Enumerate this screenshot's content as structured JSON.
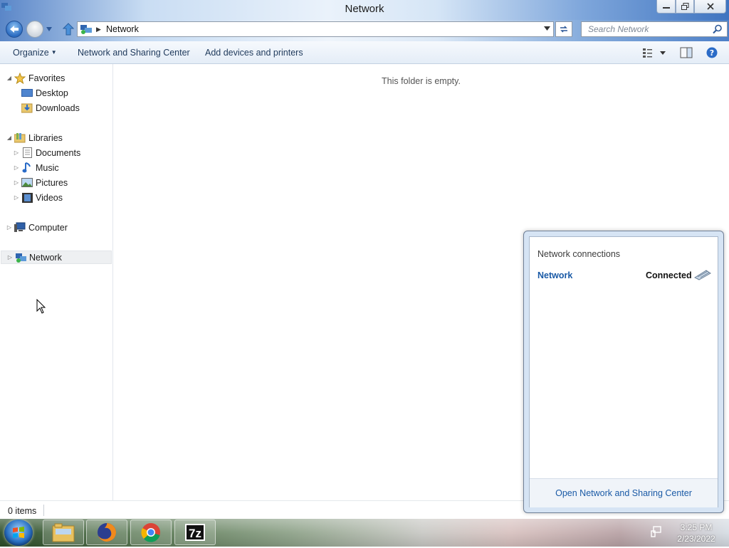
{
  "window": {
    "title": "Network"
  },
  "address_bar": {
    "location": "Network",
    "search_placeholder": "Search Network"
  },
  "commands": {
    "organize": "Organize",
    "network_sharing": "Network and Sharing Center",
    "add_devices": "Add devices and printers"
  },
  "nav_tree": {
    "favorites": {
      "label": "Favorites",
      "items": [
        "Desktop",
        "Downloads"
      ]
    },
    "libraries": {
      "label": "Libraries",
      "items": [
        "Documents",
        "Music",
        "Pictures",
        "Videos"
      ]
    },
    "computer": "Computer",
    "network": "Network"
  },
  "content": {
    "empty_message": "This folder is empty."
  },
  "status_bar": {
    "item_count": "0 items"
  },
  "network_popup": {
    "header": "Network connections",
    "connection_name": "Network",
    "connection_status": "Connected",
    "footer_link": "Open Network and Sharing Center"
  },
  "taskbar": {
    "apps": [
      "file-explorer-icon",
      "firefox-icon",
      "chrome-icon",
      "7zip-icon"
    ],
    "sevenzip_label": "7z",
    "clock_time": "3:25 PM",
    "clock_date": "2/23/2022"
  },
  "colors": {
    "link": "#1a5aa6",
    "command_text": "#1e395b"
  }
}
